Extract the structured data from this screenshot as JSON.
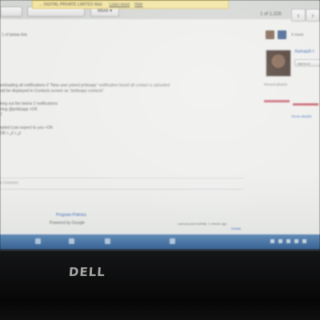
{
  "toolbar": {
    "notice_text": "... DIGITAL PRIVATE LIMITED Mail.",
    "learn_more": "Learn more",
    "hide": "Hide",
    "more_label": "More ▾"
  },
  "pager": {
    "label": "1 of 1,326",
    "prev": "‹",
    "next": "›"
  },
  "message": {
    "header": "1 of below link.",
    "body_line1": "wnloading all notifications if \"New user joined prtdsapp\" notification found all contact is uploaded",
    "body_line2": "uld be displayed in Contacts screen as \"prtdsapp contacts\"",
    "body_line3": "king out the below 2 notifications",
    "body_line4": "ning @prtdsapp <OK",
    "body_line5": "7",
    "body_line6": "epted (can expect to you <OK",
    "body_line7": "OK ال-ا ال-ا",
    "compose_hint": "e Connect"
  },
  "sidebar": {
    "people_count": "4 more",
    "name": "Avinash I",
    "add_button": "Add to ci",
    "recent_label": "Recent photos",
    "show_details": "Show details"
  },
  "footer": {
    "program_policies": "Program Policies",
    "powered_by": "Powered by Google",
    "activity": "Last account activity: 1 minute ago",
    "details": "Details"
  },
  "device": {
    "brand": "DELL"
  }
}
